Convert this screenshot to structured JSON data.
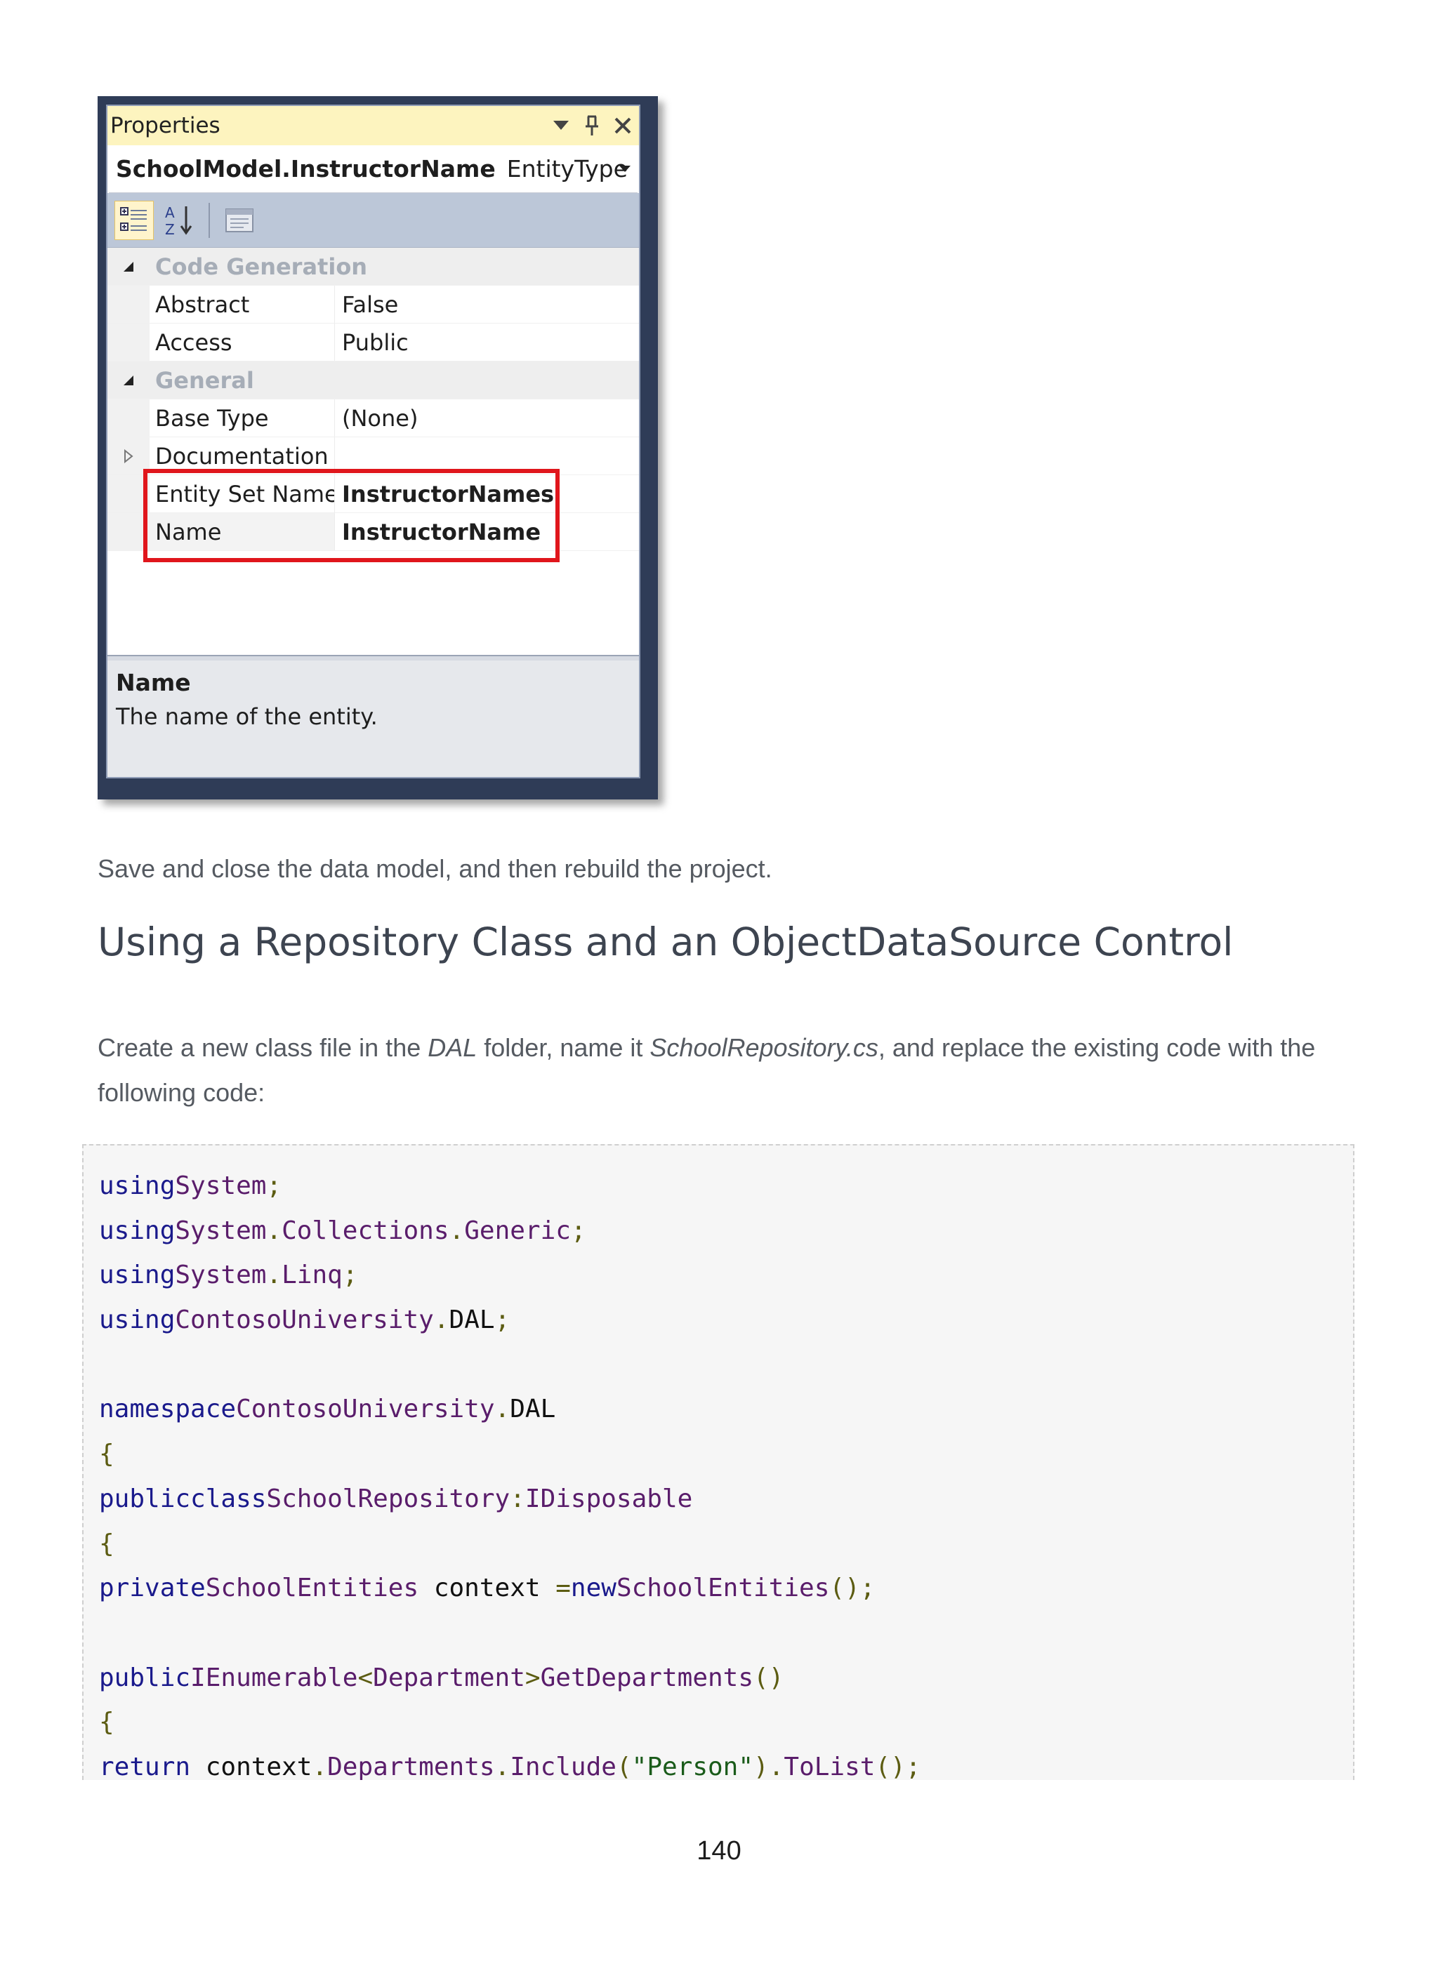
{
  "properties_window": {
    "title": "Properties",
    "object_name": "SchoolModel.InstructorName",
    "object_type": "EntityType",
    "categories": [
      {
        "label": "Code Generation",
        "rows": [
          {
            "name": "Abstract",
            "value": "False"
          },
          {
            "name": "Access",
            "value": "Public"
          }
        ]
      },
      {
        "label": "General",
        "rows": [
          {
            "name": "Base Type",
            "value": "(None)"
          },
          {
            "name": "Documentation",
            "value": ""
          },
          {
            "name": "Entity Set Name",
            "value": "InstructorNames"
          },
          {
            "name": "Name",
            "value": "InstructorName"
          }
        ]
      }
    ],
    "description_title": "Name",
    "description_text": "The name of the entity.",
    "highlight_color": "#e0161c"
  },
  "document": {
    "para1": "Save and close the data model, and then rebuild the project.",
    "heading": "Using a Repository Class and an ObjectDataSource Control",
    "para2": {
      "t1": "Create a new class file in the ",
      "dal": "DAL",
      "t2": " folder, name it ",
      "file": "SchoolRepository.cs",
      "t3": ", and replace the existing code with the",
      "t4": "following code:"
    },
    "code": {
      "l1": {
        "k": "using",
        "a": "System",
        "b": ";"
      },
      "l2": {
        "k": "using",
        "a": "System",
        "d1": ".",
        "b": "Collections",
        "d2": ".",
        "c": "Generic",
        "e": ";"
      },
      "l3": {
        "k": "using",
        "a": "System",
        "d1": ".",
        "b": "Linq",
        "e": ";"
      },
      "l4": {
        "k": "using",
        "a": "ContosoUniversity",
        "d1": ".",
        "b": "DAL",
        "e": ";"
      },
      "l6": {
        "k": "namespace",
        "a": "ContosoUniversity",
        "d1": ".",
        "b": "DAL"
      },
      "l7": "{",
      "l8": {
        "k1": "public",
        "k2": "class",
        "a": "SchoolRepository",
        "c": ":",
        "b": "IDisposable"
      },
      "l9": "{",
      "l10": {
        "k": "private",
        "a": "SchoolEntities",
        "b": " context ",
        "c": "=",
        "k2": "new",
        "d": "SchoolEntities",
        "e": "();"
      },
      "l12": {
        "k": "public",
        "a": "IEnumerable",
        "p1": "<",
        "b": "Department",
        "p2": ">",
        "c": "GetDepartments",
        "e": "()"
      },
      "l13": "{",
      "l14": {
        "k": "return",
        "a": " context",
        "d1": ".",
        "b": "Departments",
        "d2": ".",
        "c": "Include",
        "p1": "(",
        "s": "\"Person\"",
        "p2": ")",
        "d3": ".",
        "f": "ToList",
        "e": "();"
      }
    },
    "page_number": "140"
  }
}
